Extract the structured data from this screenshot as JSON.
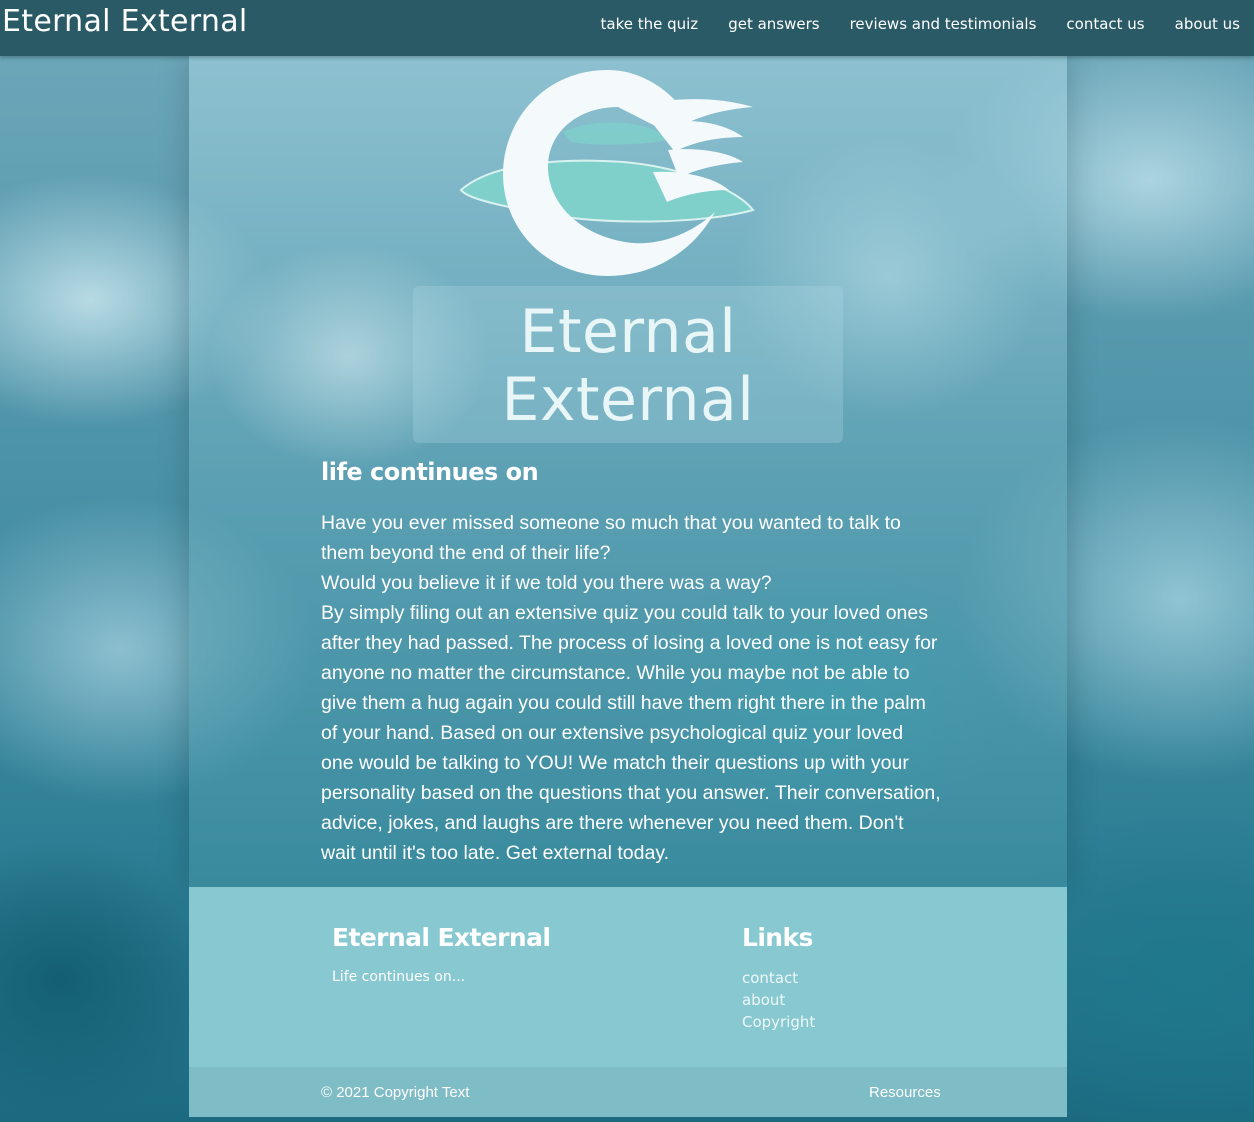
{
  "navbar": {
    "brand": "Eternal External",
    "links": [
      "take the quiz",
      "get answers",
      "reviews and testimonials",
      "contact us",
      "about us"
    ]
  },
  "hero": {
    "title_line1": "Eternal",
    "title_line2": "External",
    "logo_icon": "crescent-wave-logo"
  },
  "content": {
    "tagline": "life continues on",
    "paragraphs": [
      "Have you ever missed someone so much that you wanted to talk to them beyond the end of their life?",
      "Would you believe it if we told you there was a way?",
      "By simply filing out an extensive quiz you could talk to your loved ones after they had passed. The process of losing a loved one is not easy for anyone no matter the circumstance. While you maybe not be able to give them a hug again you could still have them right there in the palm of your hand. Based on our extensive psychological quiz your loved one would be talking to YOU! We match their questions up with your personality based on the questions that you answer. Their conversation, advice, jokes, and laughs are there whenever you need them. Don't wait until it's too late. Get external today."
    ]
  },
  "footer": {
    "brand_title": "Eternal External",
    "brand_text": "Life continues on...",
    "links_title": "Links",
    "links": [
      "contact",
      "about",
      "Copyright"
    ],
    "copyright": "© 2021 Copyright Text",
    "resources": "Resources"
  },
  "colors": {
    "navbar": "#2a5a66",
    "footer": "#87c8d1",
    "copybar": "#7ebcc6",
    "logo_white": "#f4f9fb",
    "logo_teal": "#7fcfcb"
  }
}
